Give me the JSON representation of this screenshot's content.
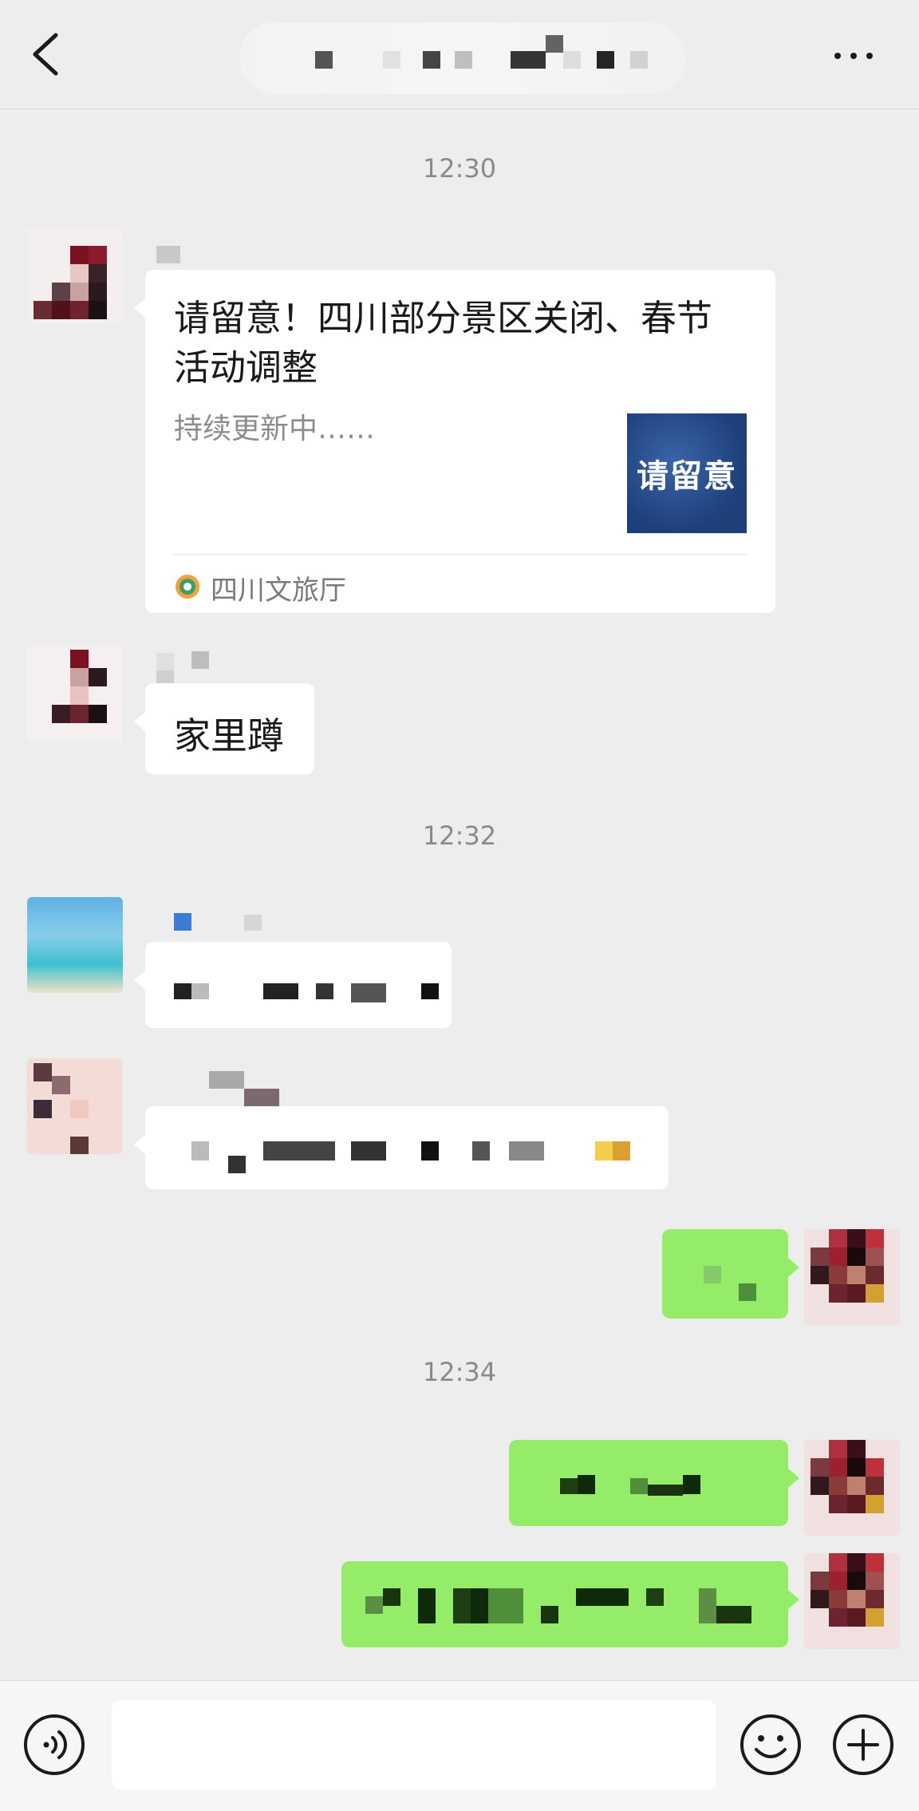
{
  "header": {
    "back_icon": "chevron-left-icon",
    "more_icon": "more-horizontal-icon"
  },
  "timestamps": [
    "12:30",
    "12:32",
    "12:34"
  ],
  "messages": {
    "card": {
      "title": "请留意！四川部分景区关闭、春节活动调整",
      "description": "持续更新中……",
      "thumbnail_text": "请留意",
      "source": "四川文旅厅"
    },
    "text_reply": "家里蹲"
  },
  "input_bar": {
    "voice_icon": "voice-icon",
    "emoji_icon": "emoji-icon",
    "plus_icon": "plus-icon"
  },
  "colors": {
    "background": "#ededed",
    "bubble_white": "#ffffff",
    "bubble_green": "#95ec69"
  }
}
